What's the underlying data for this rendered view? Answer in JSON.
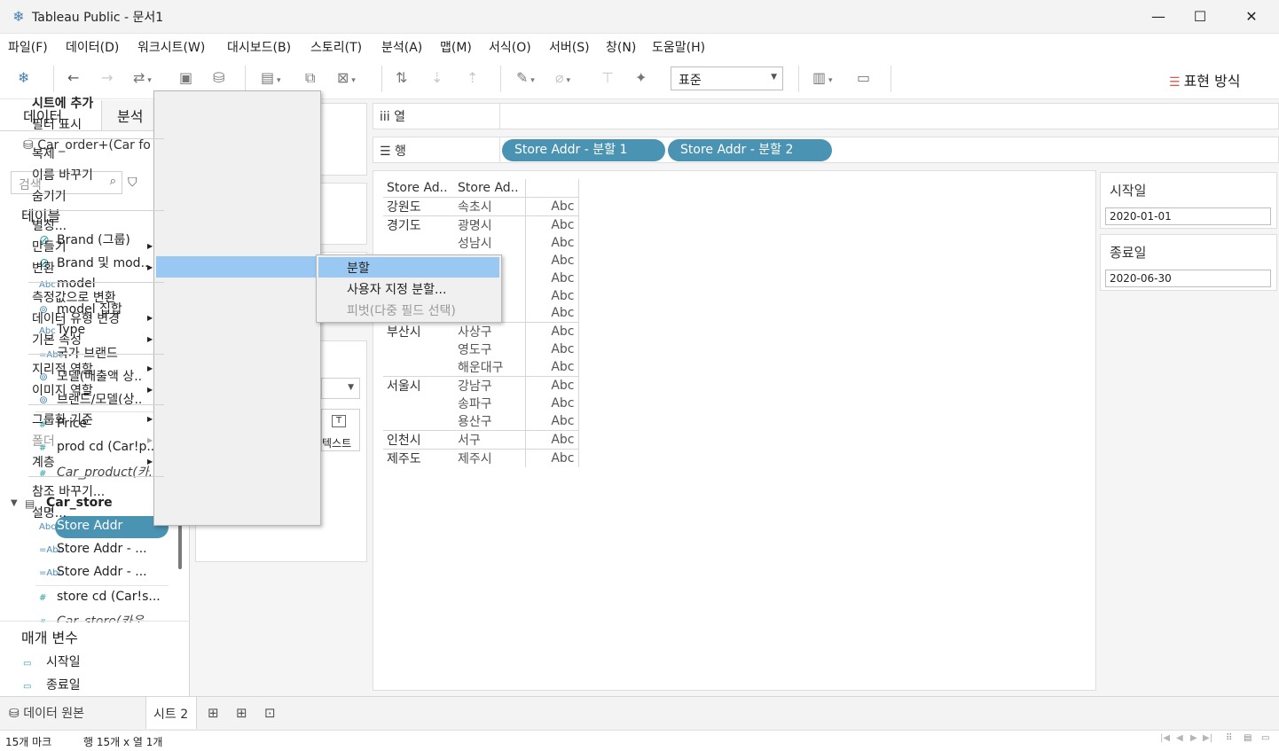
{
  "window": {
    "title": "Tableau Public - 문서1",
    "minimize": "—",
    "maximize": "☐",
    "close": "✕"
  },
  "menubar": [
    "파일(F)",
    "데이터(D)",
    "워크시트(W)",
    "대시보드(B)",
    "스토리(T)",
    "분석(A)",
    "맵(M)",
    "서식(O)",
    "서버(S)",
    "창(N)",
    "도움말(H)"
  ],
  "toolbar": {
    "fit_value": "표준",
    "show_me": "표현 방식"
  },
  "data_pane": {
    "tabs": [
      "데이터",
      "분석"
    ],
    "datasource": "Car_order+(Car fo",
    "search_placeholder": "검색",
    "tables_header": "테이블",
    "fields": [
      {
        "icon": "🔗",
        "name": "Brand (그룹)"
      },
      {
        "icon": "🔗",
        "name": "Brand 및 mod.."
      },
      {
        "icon": "Abc",
        "name": "model"
      },
      {
        "icon": "⊚",
        "name": "model 집합"
      },
      {
        "icon": "Abc",
        "name": "Type"
      },
      {
        "icon": "=Abc",
        "name": "국가 브랜드"
      },
      {
        "icon": "⊚",
        "name": "모델(매출액 상.."
      },
      {
        "icon": "⊚",
        "name": "브랜드/모델(상.."
      },
      {
        "icon": "#",
        "name": "Price"
      },
      {
        "icon": "#",
        "name": "prod cd (Car!p.."
      },
      {
        "icon": "#",
        "name": "Car_product(카.."
      }
    ],
    "store_table": "Car_store",
    "store_fields": [
      {
        "icon": "Abc",
        "name": "Store Addr"
      },
      {
        "icon": "=Abc",
        "name": "Store Addr - ..."
      },
      {
        "icon": "=Abc",
        "name": "Store Addr - ..."
      },
      {
        "icon": "#",
        "name": "store cd (Car!s..."
      },
      {
        "icon": "#",
        "name": "Car_store(카운.."
      }
    ],
    "params_header": "매개 변수",
    "params": [
      "시작일",
      "종료일"
    ]
  },
  "shelves": {
    "columns_label": "열",
    "rows_label": "행",
    "row_pills": [
      "Store Addr - 분할 1",
      "Store Addr - 분할 2"
    ]
  },
  "marks": {
    "text_label": "텍스트"
  },
  "crosstab": {
    "headers": [
      "Store Ad..",
      "Store Ad..",
      ""
    ],
    "rows": [
      {
        "c1": "강원도",
        "c2": "속초시",
        "c3": "Abc",
        "grp": true
      },
      {
        "c1": "경기도",
        "c2": "광명시",
        "c3": "Abc",
        "grp": true
      },
      {
        "c1": "",
        "c2": "성남시",
        "c3": "Abc",
        "grp": false
      },
      {
        "c1": "",
        "c2": "",
        "c3": "Abc",
        "grp": false
      },
      {
        "c1": "",
        "c2": "",
        "c3": "Abc",
        "grp": false
      },
      {
        "c1": "",
        "c2": "",
        "c3": "Abc",
        "grp": false
      },
      {
        "c1": "",
        "c2": "",
        "c3": "Abc",
        "grp": false
      },
      {
        "c1": "부산시",
        "c2": "사상구",
        "c3": "Abc",
        "grp": true
      },
      {
        "c1": "",
        "c2": "영도구",
        "c3": "Abc",
        "grp": false
      },
      {
        "c1": "",
        "c2": "해운대구",
        "c3": "Abc",
        "grp": false
      },
      {
        "c1": "서울시",
        "c2": "강남구",
        "c3": "Abc",
        "grp": true
      },
      {
        "c1": "",
        "c2": "송파구",
        "c3": "Abc",
        "grp": false
      },
      {
        "c1": "",
        "c2": "용산구",
        "c3": "Abc",
        "grp": false
      },
      {
        "c1": "인천시",
        "c2": "서구",
        "c3": "Abc",
        "grp": true
      },
      {
        "c1": "제주도",
        "c2": "제주시",
        "c3": "Abc",
        "grp": true
      }
    ]
  },
  "param_cards": [
    {
      "title": "시작일",
      "value": "2020-01-01"
    },
    {
      "title": "종료일",
      "value": "2020-06-30"
    }
  ],
  "context_menu": {
    "items": {
      "add_to_sheet": "시트에 추가",
      "show_filter": "필터 표시",
      "duplicate": "복제",
      "rename": "이름 바꾸기",
      "hide": "숨기기",
      "alias": "별칭...",
      "create": "만들기",
      "transform": "변환",
      "convert_measure": "측정값으로 변환",
      "change_type": "데이터 유형 변경",
      "default_props": "기본 속성",
      "geo_role": "지리적 역할",
      "image_role": "이미지 역할",
      "group_by": "그룹화 기준",
      "folder": "폴더",
      "hierarchy": "계층",
      "replace_ref": "참조 바꾸기...",
      "describe": "설명..."
    },
    "submenu": [
      "분할",
      "사용자 지정 분할...",
      "피벗(다중 필드 선택)"
    ]
  },
  "sheets": {
    "datasource_tab": "데이터 원본",
    "active_sheet": "시트 2"
  },
  "status": {
    "marks": "15개 마크",
    "dims": "행 15개  x  열 1개"
  }
}
